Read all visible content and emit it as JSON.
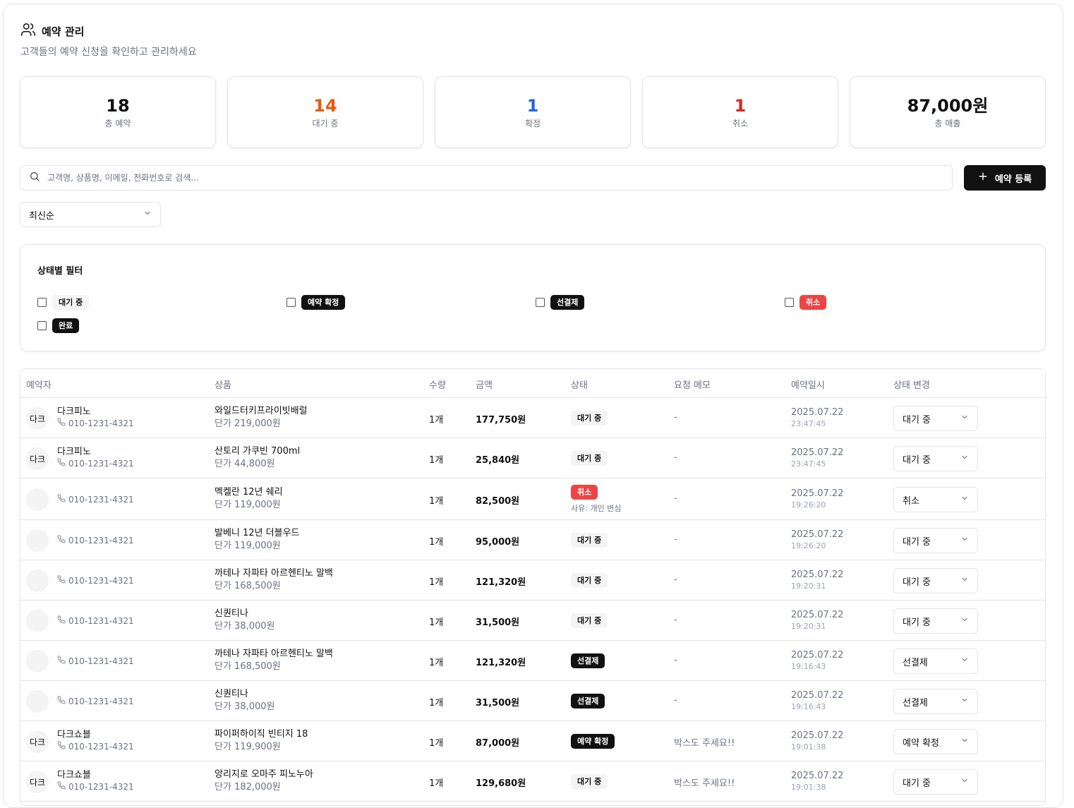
{
  "header": {
    "title": "예약 관리",
    "subtitle": "고객들의 예약 신청을 확인하고 관리하세요"
  },
  "stats": [
    {
      "value": "18",
      "label": "총 예약",
      "color": "#111111"
    },
    {
      "value": "14",
      "label": "대기 중",
      "color": "#ea580c"
    },
    {
      "value": "1",
      "label": "확정",
      "color": "#2563eb"
    },
    {
      "value": "1",
      "label": "취소",
      "color": "#dc2626"
    },
    {
      "value": "87,000원",
      "label": "총 매출",
      "color": "#111111"
    }
  ],
  "search": {
    "placeholder": "고객명, 상품명, 이메일, 전화번호로 검색...",
    "value": ""
  },
  "add_button": {
    "label": "예약 등록"
  },
  "sort": {
    "selected": "최신순"
  },
  "filter": {
    "title": "상태별 필터",
    "options": [
      {
        "label": "대기 중",
        "style": "gray"
      },
      {
        "label": "예약 확정",
        "style": "dark"
      },
      {
        "label": "선결제",
        "style": "dark"
      },
      {
        "label": "취소",
        "style": "red"
      },
      {
        "label": "완료",
        "style": "dark"
      }
    ]
  },
  "table": {
    "columns": [
      "예약자",
      "상품",
      "수량",
      "금액",
      "상태",
      "요청 메모",
      "예약일시",
      "상태 변경"
    ],
    "rows": [
      {
        "avatar": "다크",
        "name": "다크피노",
        "phone": "010-1231-4321",
        "product": "와일드터키프라이빗배럴",
        "unit": "단가 219,000원",
        "qty": "1개",
        "amount": "177,750원",
        "status": "대기 중",
        "status_style": "gray",
        "reason": "",
        "memo": "-",
        "date": "2025.07.22",
        "time": "23:47:45",
        "select": "대기 중"
      },
      {
        "avatar": "다크",
        "name": "다크피노",
        "phone": "010-1231-4321",
        "product": "산토리 가쿠빈 700ml",
        "unit": "단가 44,800원",
        "qty": "1개",
        "amount": "25,840원",
        "status": "대기 중",
        "status_style": "gray",
        "reason": "",
        "memo": "-",
        "date": "2025.07.22",
        "time": "23:47:45",
        "select": "대기 중"
      },
      {
        "avatar": "",
        "name": "",
        "phone": "010-1231-4321",
        "product": "멕켈란 12년 쉐리",
        "unit": "단가 119,000원",
        "qty": "1개",
        "amount": "82,500원",
        "status": "취소",
        "status_style": "red",
        "reason": "사유: 개인 변심",
        "memo": "-",
        "date": "2025.07.22",
        "time": "19:26:20",
        "select": "취소"
      },
      {
        "avatar": "",
        "name": "",
        "phone": "010-1231-4321",
        "product": "발베니 12년 더블우드",
        "unit": "단가 119,000원",
        "qty": "1개",
        "amount": "95,000원",
        "status": "대기 중",
        "status_style": "gray",
        "reason": "",
        "memo": "-",
        "date": "2025.07.22",
        "time": "19:26:20",
        "select": "대기 중"
      },
      {
        "avatar": "",
        "name": "",
        "phone": "010-1231-4321",
        "product": "까테나 자파타 아르헨티노 말백",
        "unit": "단가 168,500원",
        "qty": "1개",
        "amount": "121,320원",
        "status": "대기 중",
        "status_style": "gray",
        "reason": "",
        "memo": "-",
        "date": "2025.07.22",
        "time": "19:20:31",
        "select": "대기 중"
      },
      {
        "avatar": "",
        "name": "",
        "phone": "010-1231-4321",
        "product": "신퀀티나",
        "unit": "단가 38,000원",
        "qty": "1개",
        "amount": "31,500원",
        "status": "대기 중",
        "status_style": "gray",
        "reason": "",
        "memo": "-",
        "date": "2025.07.22",
        "time": "19:20:31",
        "select": "대기 중"
      },
      {
        "avatar": "",
        "name": "",
        "phone": "010-1231-4321",
        "product": "까테나 자파타 아르헨티노 말백",
        "unit": "단가 168,500원",
        "qty": "1개",
        "amount": "121,320원",
        "status": "선결제",
        "status_style": "dark",
        "reason": "",
        "memo": "-",
        "date": "2025.07.22",
        "time": "19:16:43",
        "select": "선결제"
      },
      {
        "avatar": "",
        "name": "",
        "phone": "010-1231-4321",
        "product": "신퀀티나",
        "unit": "단가 38,000원",
        "qty": "1개",
        "amount": "31,500원",
        "status": "선결제",
        "status_style": "dark",
        "reason": "",
        "memo": "-",
        "date": "2025.07.22",
        "time": "19:16:43",
        "select": "선결제"
      },
      {
        "avatar": "다크",
        "name": "다크쇼블",
        "phone": "010-1231-4321",
        "product": "파이퍼하이직 빈티지 18",
        "unit": "단가 119,900원",
        "qty": "1개",
        "amount": "87,000원",
        "status": "예약 확정",
        "status_style": "dark",
        "reason": "",
        "memo": "박스도 주세요!!",
        "date": "2025.07.22",
        "time": "19:01:38",
        "select": "예약 확정"
      },
      {
        "avatar": "다크",
        "name": "다크쇼블",
        "phone": "010-1231-4321",
        "product": "앙리지로 오마주 피노누아",
        "unit": "단가 182,000원",
        "qty": "1개",
        "amount": "129,680원",
        "status": "대기 중",
        "status_style": "gray",
        "reason": "",
        "memo": "박스도 주세요!!",
        "date": "2025.07.22",
        "time": "19:01:38",
        "select": "대기 중"
      }
    ]
  }
}
